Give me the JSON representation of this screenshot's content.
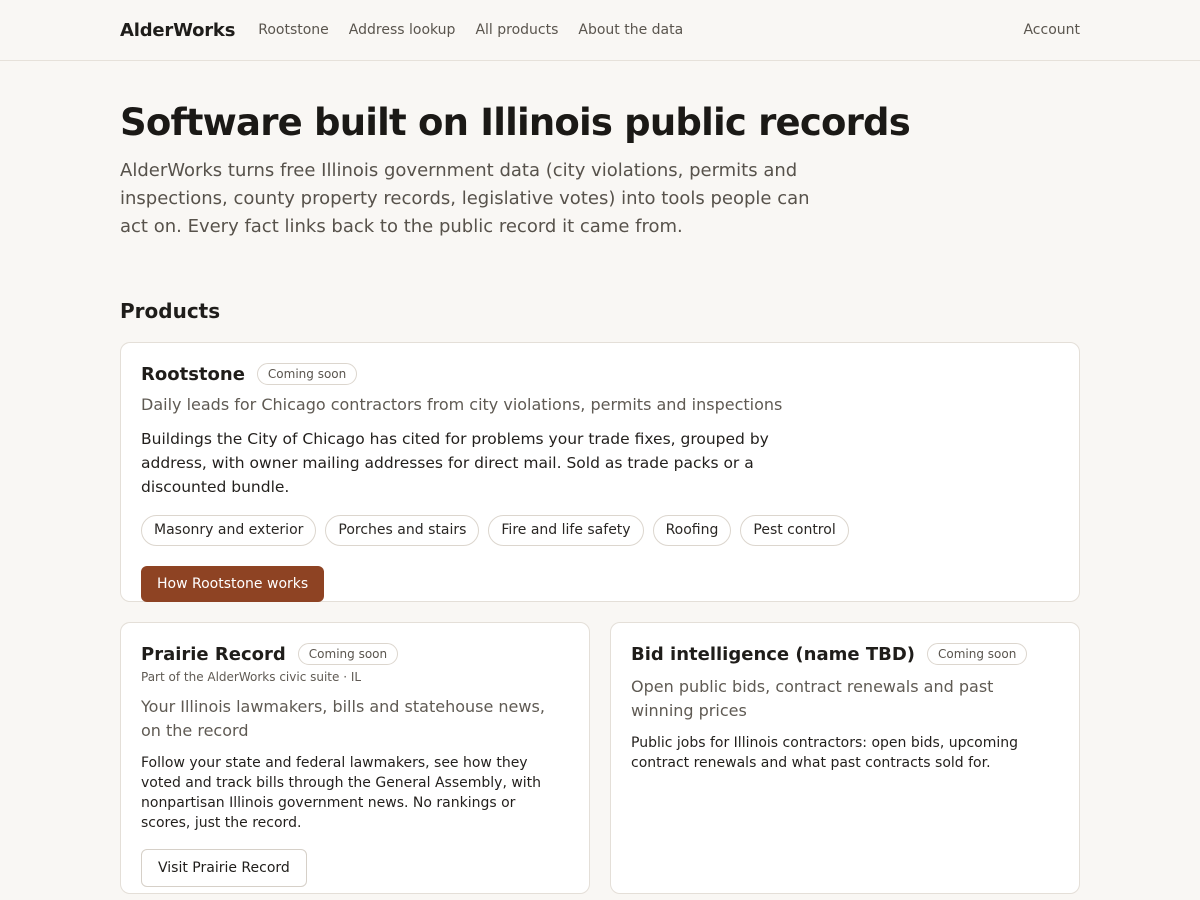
{
  "header": {
    "brand": "AlderWorks",
    "nav": [
      "Rootstone",
      "Address lookup",
      "All products",
      "About the data"
    ],
    "account": "Account"
  },
  "hero": {
    "title": "Software built on Illinois public records",
    "intro": "AlderWorks turns free Illinois government data (city violations, permits and inspections, county property records, legislative votes) into tools people can act on. Every fact links back to the public record it came from."
  },
  "products": {
    "heading": "Products",
    "rootstone": {
      "title": "Rootstone",
      "badge": "Coming soon",
      "tagline": "Daily leads for Chicago contractors from city violations, permits and inspections",
      "description": "Buildings the City of Chicago has cited for problems your trade fixes, grouped by address, with owner mailing addresses for direct mail. Sold as trade packs or a discounted bundle.",
      "chips": [
        "Masonry and exterior",
        "Porches and stairs",
        "Fire and life safety",
        "Roofing",
        "Pest control"
      ],
      "cta": "How Rootstone works"
    },
    "prairie": {
      "title": "Prairie Record",
      "badge": "Coming soon",
      "suite": "Part of the AlderWorks civic suite · IL",
      "tagline": "Your Illinois lawmakers, bills and statehouse news, on the record",
      "description": "Follow your state and federal lawmakers, see how they voted and track bills through the General Assembly, with nonpartisan Illinois government news. No rankings or scores, just the record.",
      "cta": "Visit Prairie Record"
    },
    "bid": {
      "title": "Bid intelligence (name TBD)",
      "badge": "Coming soon",
      "tagline": "Open public bids, contract renewals and past winning prices",
      "description": "Public jobs for Illinois contractors: open bids, upcoming contract renewals and what past contracts sold for."
    }
  }
}
